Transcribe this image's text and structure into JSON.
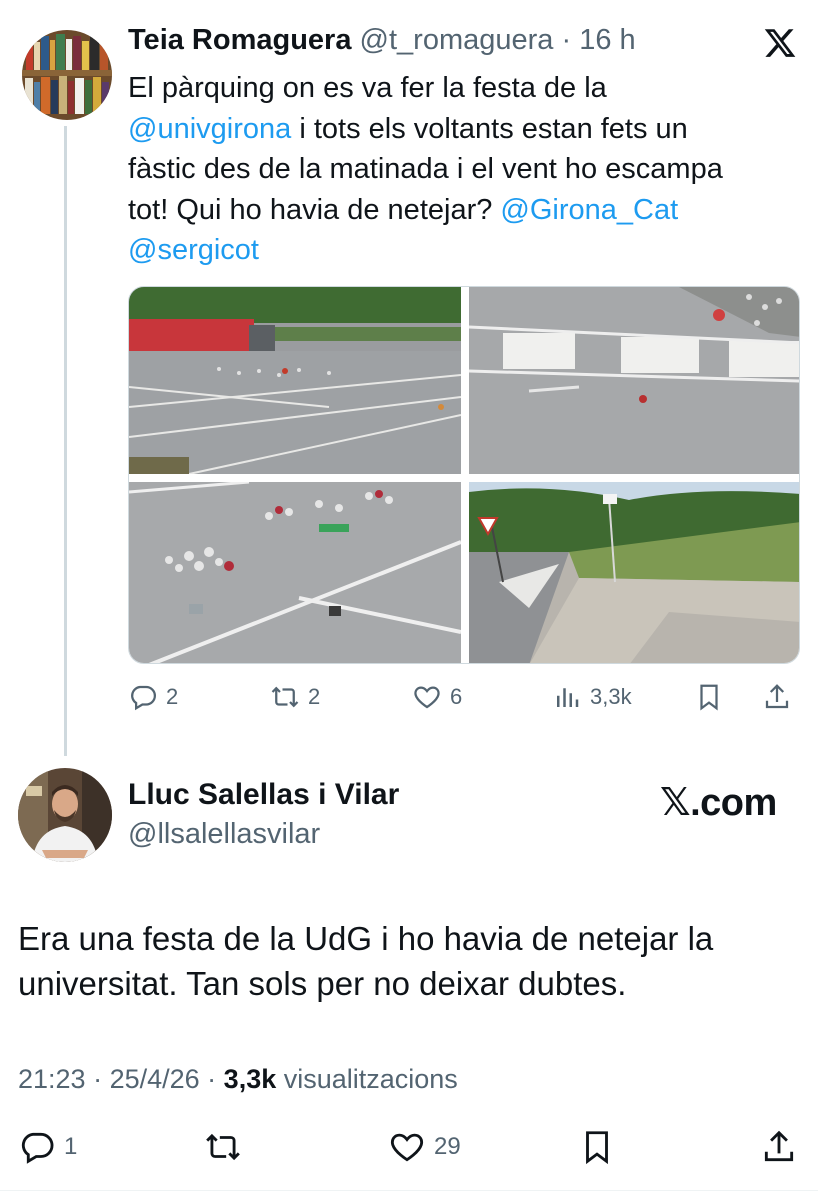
{
  "tweet": {
    "author_name": "Teia Romaguera",
    "handle": "@t_romaguera",
    "separator": "·",
    "time": "16 h",
    "text_lines": [
      [
        {
          "t": "El pàrquing on es va fer la festa de la",
          "m": false
        }
      ],
      [
        {
          "t": "@univgirona",
          "m": true
        },
        {
          "t": " i tots els voltants estan fets un",
          "m": false
        }
      ],
      [
        {
          "t": "fàstic des de la matinada i el vent ho escampa",
          "m": false
        }
      ],
      [
        {
          "t": "tot! Qui ho havia de netejar? ",
          "m": false
        },
        {
          "t": "@Girona_Cat",
          "m": true
        }
      ],
      [
        {
          "t": "@sergicot",
          "m": true
        }
      ]
    ],
    "images": [
      "parking-lot-litter",
      "crosswalk-litter",
      "cans-on-asphalt",
      "roadside-litter"
    ],
    "stats": {
      "replies": "2",
      "reposts": "2",
      "likes": "6",
      "views": "3,3k"
    }
  },
  "reply": {
    "author_name": "Lluc Salellas i Vilar",
    "handle": "@llsalellasvilar",
    "brand": "𝕏.com",
    "text_lines": [
      "Era una festa de la UdG i ho havia de netejar la",
      "universitat. Tan sols per no deixar dubtes."
    ],
    "time": "21:23",
    "sep1": " · ",
    "date": "25/4/26",
    "sep2": " · ",
    "views": "3,3k",
    "views_label": " visualitzacions",
    "stats": {
      "replies": "1",
      "likes": "29"
    }
  },
  "icons": [
    "x-logo-icon",
    "reply-icon",
    "repost-icon",
    "like-icon",
    "views-icon",
    "bookmark-icon",
    "share-icon"
  ],
  "colors": {
    "link": "#1d9bf0",
    "secondary": "#536471",
    "text": "#0f1419",
    "thread": "#cfd9de"
  }
}
